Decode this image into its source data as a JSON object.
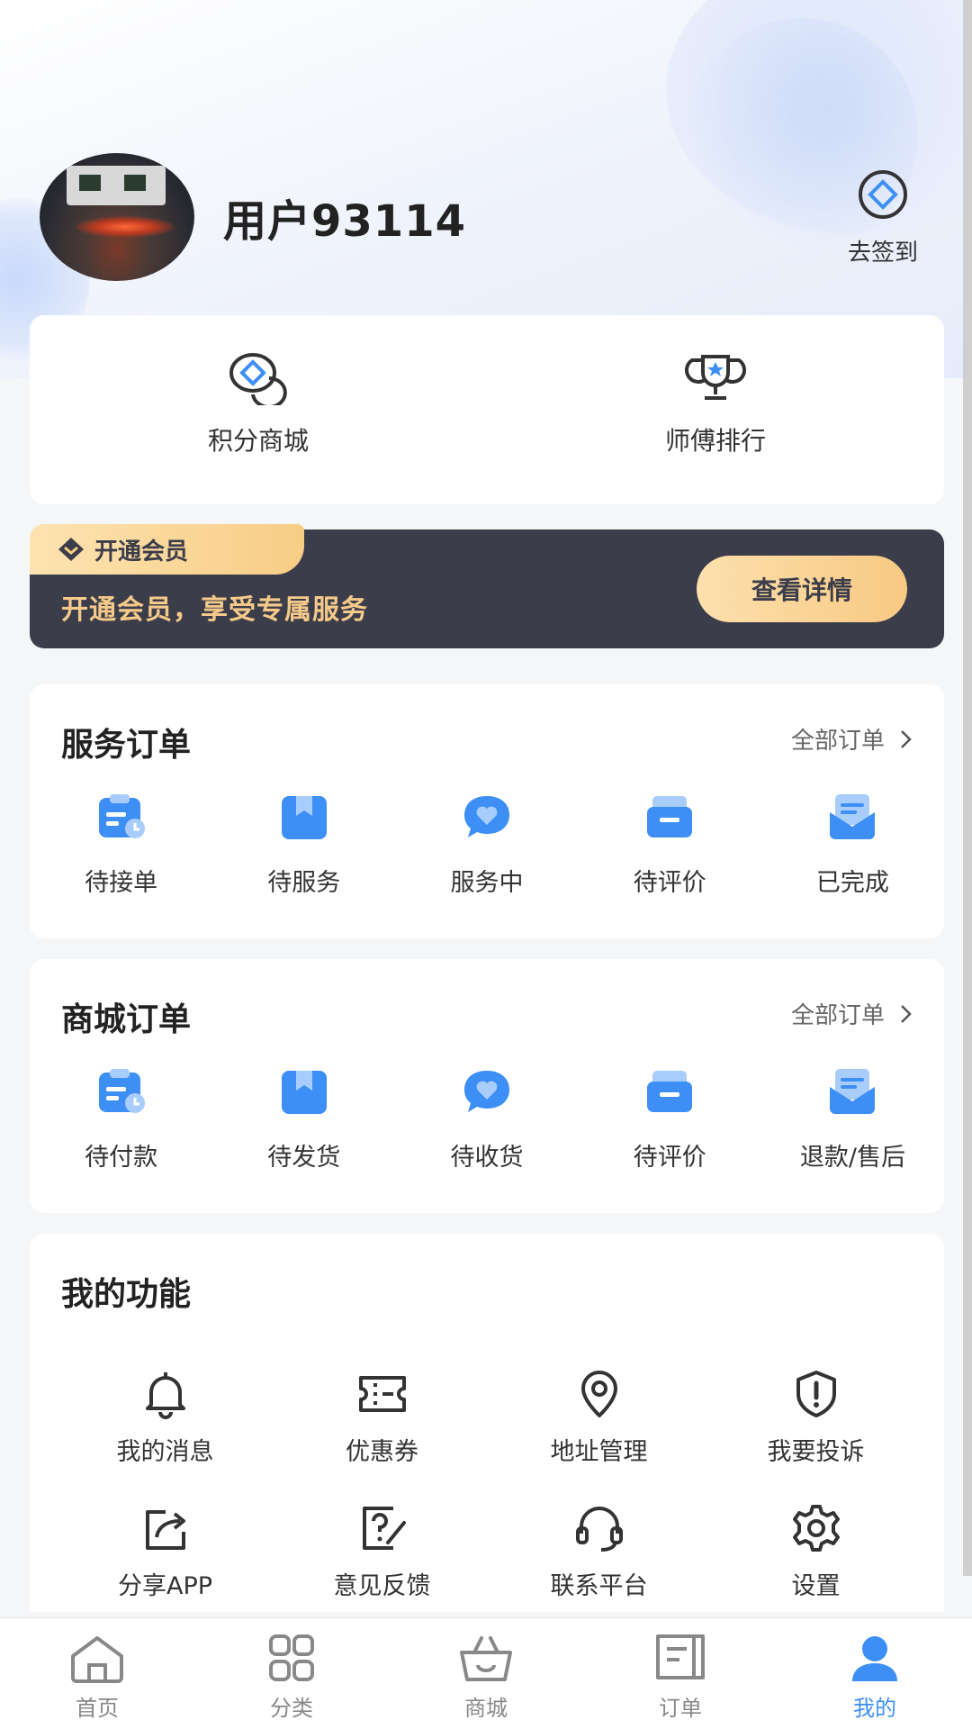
{
  "colors": {
    "accent": "#3d8ff5",
    "vip_dark": "#3c3d4a",
    "vip_gold": "#f5c98a"
  },
  "profile": {
    "username": "用户93114",
    "signin_label": "去签到"
  },
  "quick": [
    {
      "label": "积分商城",
      "icon": "points-mall-icon"
    },
    {
      "label": "师傅排行",
      "icon": "trophy-icon"
    }
  ],
  "vip": {
    "tag": "开通会员",
    "text": "开通会员，享受专属服务",
    "button": "查看详情"
  },
  "service_orders": {
    "title": "服务订单",
    "all_label": "全部订单",
    "items": [
      "待接单",
      "待服务",
      "服务中",
      "待评价",
      "已完成"
    ]
  },
  "mall_orders": {
    "title": "商城订单",
    "all_label": "全部订单",
    "items": [
      "待付款",
      "待发货",
      "待收货",
      "待评价",
      "退款/售后"
    ]
  },
  "functions": {
    "title": "我的功能",
    "items": [
      "我的消息",
      "优惠券",
      "地址管理",
      "我要投诉",
      "分享APP",
      "意见反馈",
      "联系平台",
      "设置"
    ]
  },
  "nav": {
    "tabs": [
      "首页",
      "分类",
      "商城",
      "订单",
      "我的"
    ],
    "active": "我的"
  }
}
